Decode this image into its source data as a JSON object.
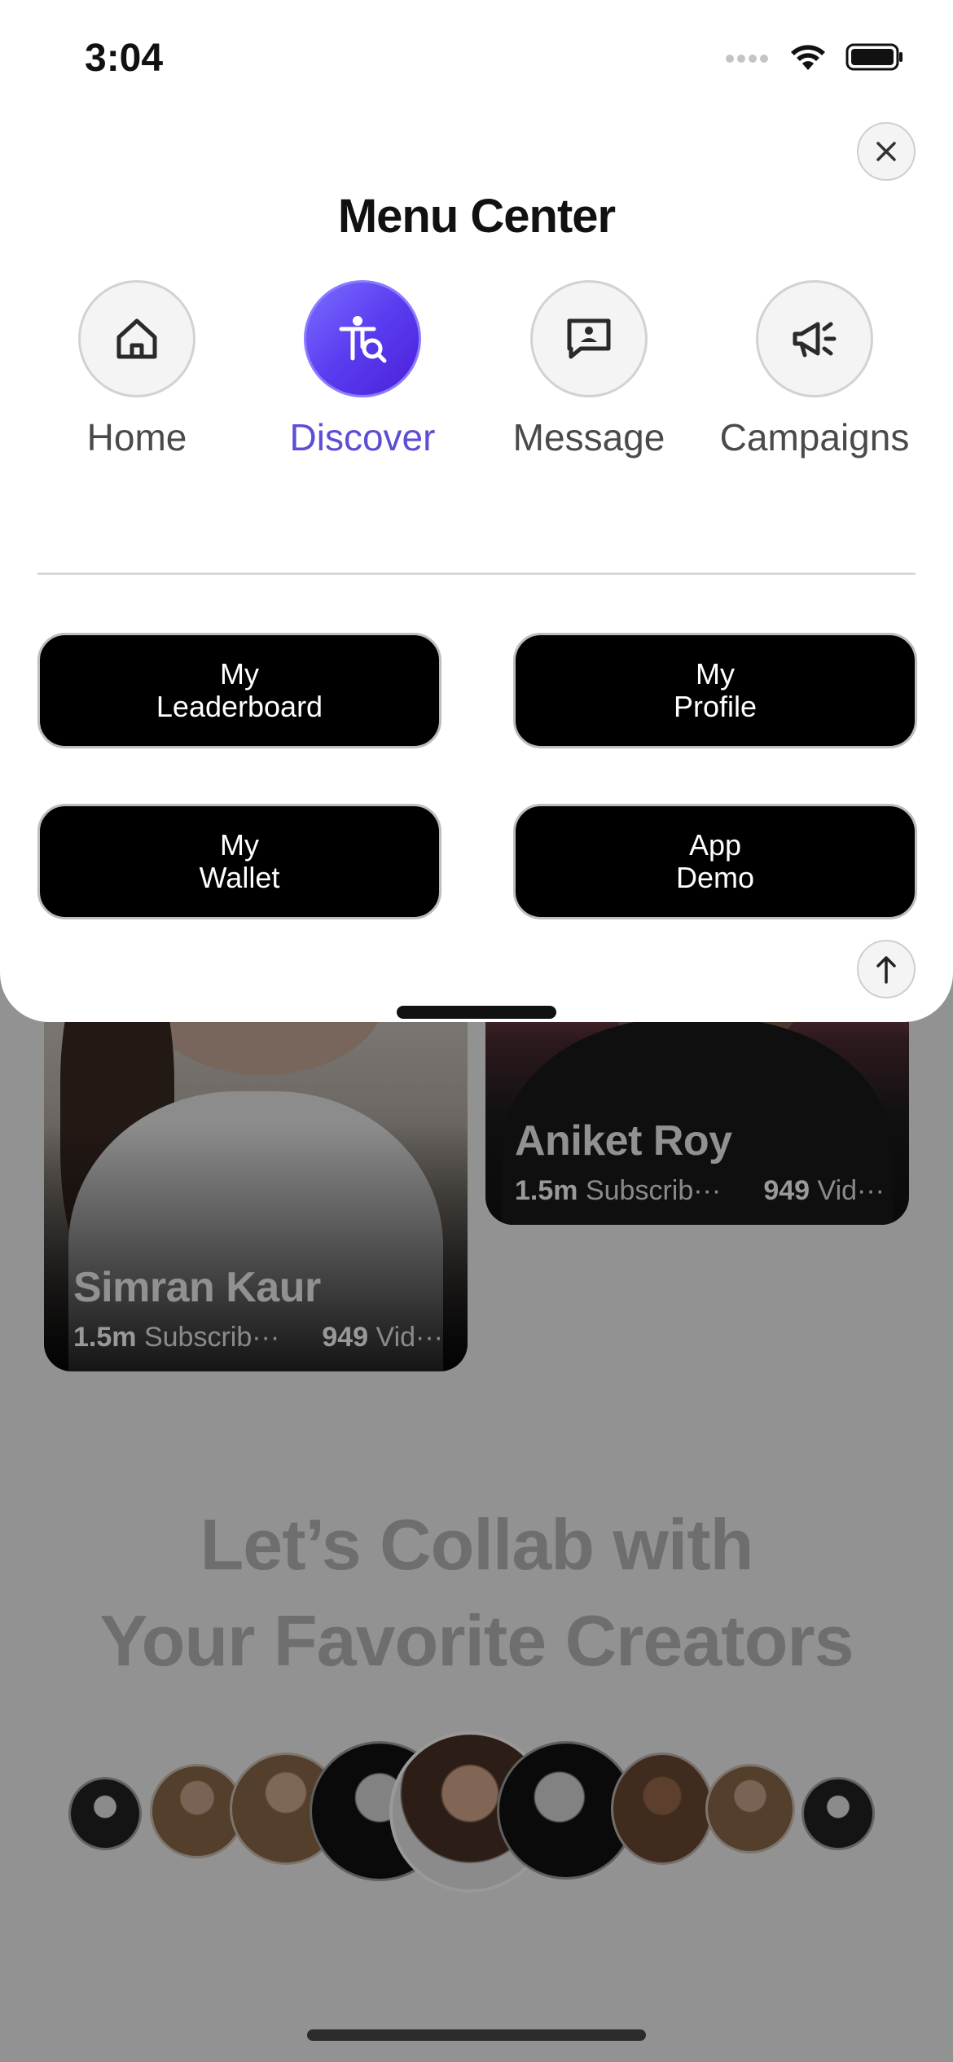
{
  "status_bar": {
    "time": "3:04"
  },
  "menu": {
    "title": "Menu Center",
    "nav": [
      {
        "label": "Home",
        "icon": "home-icon"
      },
      {
        "label": "Discover",
        "icon": "discover-icon",
        "active": true
      },
      {
        "label": "Message",
        "icon": "message-icon"
      },
      {
        "label": "Campaigns",
        "icon": "megaphone-icon"
      }
    ],
    "quick_links": [
      {
        "line1": "My",
        "line2": "Leaderboard"
      },
      {
        "line1": "My",
        "line2": "Profile"
      },
      {
        "line1": "My",
        "line2": "Wallet"
      },
      {
        "line1": "App",
        "line2": "Demo"
      }
    ]
  },
  "background": {
    "creators": [
      {
        "name": "Simran Kaur",
        "subscribers_value": "1.5m",
        "subscribers_label": "Subscrib···",
        "videos_value": "949",
        "videos_label": "Vid···"
      },
      {
        "name": "Aniket Roy",
        "subscribers_value": "1.5m",
        "subscribers_label": "Subscrib···",
        "videos_value": "949",
        "videos_label": "Vid···"
      }
    ],
    "headline_line1": "Let’s Collab with",
    "headline_line2": "Your Favorite Creators"
  },
  "colors": {
    "accent": "#5b4fd6",
    "accent_gradient_start": "#7b6cff",
    "accent_gradient_end": "#4b1fd8"
  }
}
